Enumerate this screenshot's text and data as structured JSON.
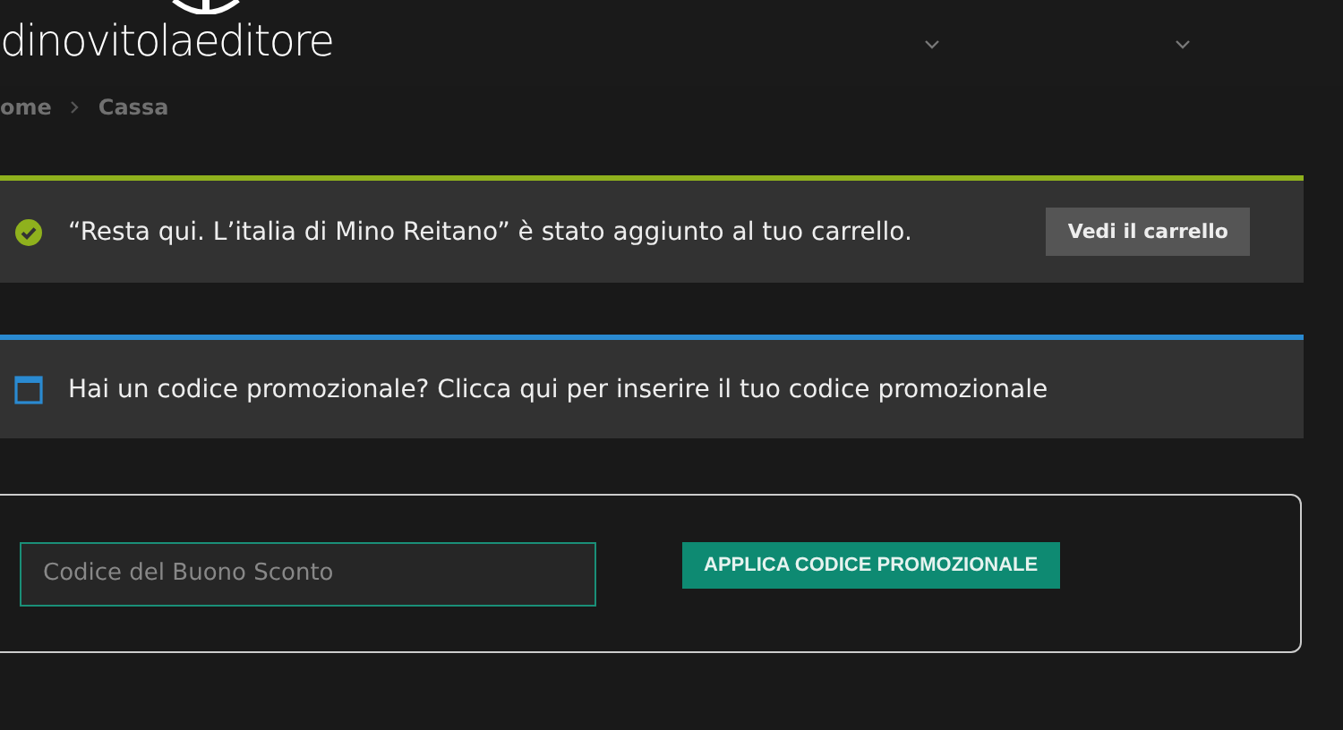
{
  "header": {
    "logo": "dinovitolaeditore",
    "nav_dropdowns": [
      {
        "has_dropdown": true
      },
      {
        "has_dropdown": true
      }
    ]
  },
  "breadcrumb": [
    "ome",
    "Cassa"
  ],
  "notices": [
    {
      "kind": "success",
      "message": "“Resta qui. L’italia di Mino Reitano” è stato aggiunto al tuo carrello.",
      "button": "Vedi il carrello"
    },
    {
      "kind": "info",
      "message": "Hai un codice promozionale? Clicca qui per inserire il tuo codice promozionale"
    }
  ],
  "coupon_form": {
    "placeholder": "Codice del Buono Sconto",
    "button": "APPLICA CODICE PROMOZIONALE"
  }
}
